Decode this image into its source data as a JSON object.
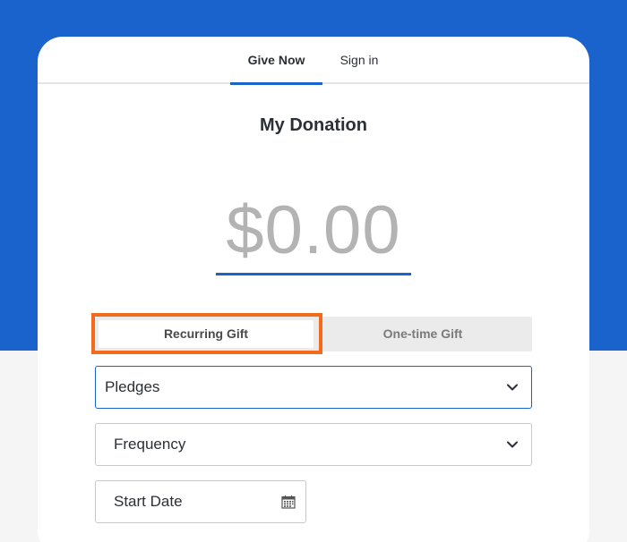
{
  "tabs": {
    "give_now": "Give Now",
    "sign_in": "Sign in"
  },
  "title": "My Donation",
  "amount": "$0.00",
  "gift_type": {
    "recurring": "Recurring Gift",
    "one_time": "One-time Gift",
    "selected": "Recurring Gift"
  },
  "fields": {
    "pledges": "Pledges",
    "frequency": "Frequency",
    "start_date": "Start Date"
  },
  "colors": {
    "brand_blue": "#1a62cc",
    "highlight": "#f26b1d"
  },
  "icons": {
    "dropdown": "chevron-down-icon",
    "calendar": "calendar-icon"
  }
}
